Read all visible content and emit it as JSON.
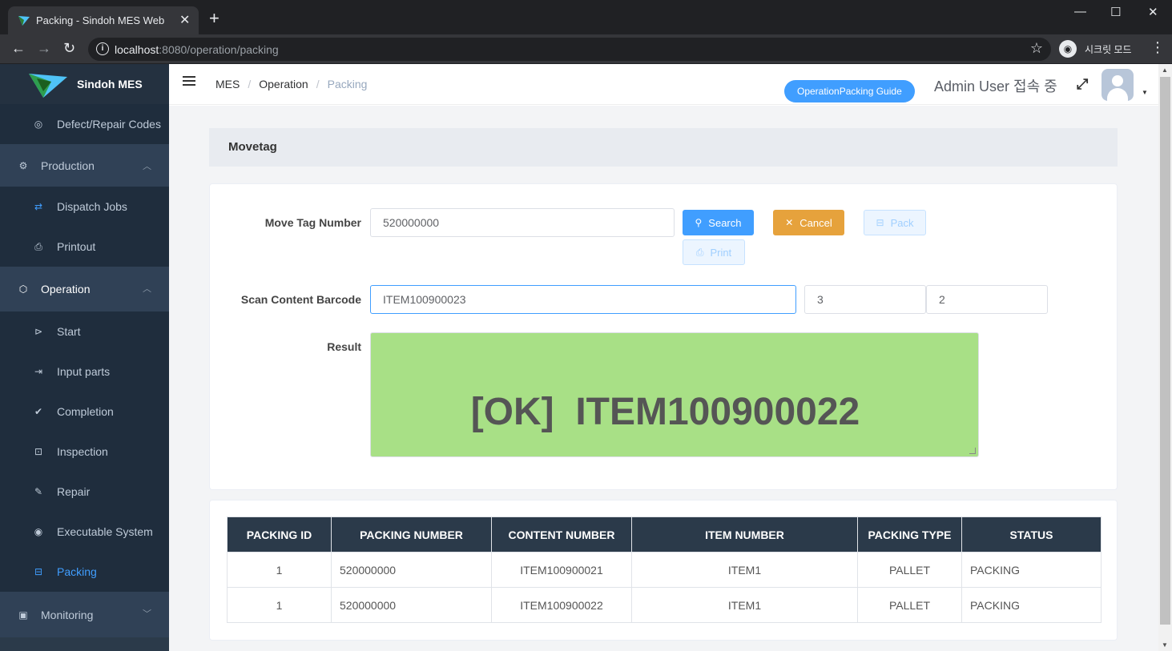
{
  "browser": {
    "tab_title": "Packing - Sindoh MES Web",
    "url_host": "localhost",
    "url_path": ":8080/operation/packing",
    "incognito_label": "시크릿 모드"
  },
  "sidebar": {
    "brand": "Sindoh MES",
    "items": [
      {
        "label": "Defect/Repair Codes",
        "icon": "search-circle-icon",
        "type": "sub"
      },
      {
        "label": "Production",
        "icon": "gear-icon",
        "type": "head",
        "open": true
      },
      {
        "label": "Dispatch Jobs",
        "icon": "sync-icon",
        "type": "sub"
      },
      {
        "label": "Printout",
        "icon": "printer-icon",
        "type": "sub"
      },
      {
        "label": "Operation",
        "icon": "box-icon",
        "type": "head",
        "open": true
      },
      {
        "label": "Start",
        "icon": "play-circle-icon",
        "type": "sub"
      },
      {
        "label": "Input parts",
        "icon": "login-icon",
        "type": "sub"
      },
      {
        "label": "Completion",
        "icon": "check-circle-icon",
        "type": "sub"
      },
      {
        "label": "Inspection",
        "icon": "scan-icon",
        "type": "sub"
      },
      {
        "label": "Repair",
        "icon": "wrench-icon",
        "type": "sub"
      },
      {
        "label": "Executable System",
        "icon": "system-icon",
        "type": "sub"
      },
      {
        "label": "Packing",
        "icon": "packing-icon",
        "type": "sub",
        "active": true
      },
      {
        "label": "Monitoring",
        "icon": "monitor-icon",
        "type": "head",
        "open": false
      }
    ]
  },
  "navbar": {
    "breadcrumbs": [
      "MES",
      "Operation",
      "Packing"
    ],
    "guide_button": "OperationPacking Guide",
    "user_label": "Admin User 접속 중"
  },
  "section": {
    "title": "Movetag"
  },
  "form": {
    "move_tag_label": "Move Tag Number",
    "move_tag_value": "520000000",
    "search_label": "Search",
    "cancel_label": "Cancel",
    "pack_label": "Pack",
    "print_label": "Print",
    "scan_label": "Scan Content Barcode",
    "scan_value": "ITEM100900023",
    "count_a": "3",
    "count_b": "2",
    "result_label": "Result",
    "result_value": "[OK]  ITEM100900022"
  },
  "table": {
    "headers": [
      "PACKING ID",
      "PACKING NUMBER",
      "CONTENT NUMBER",
      "ITEM NUMBER",
      "PACKING TYPE",
      "STATUS"
    ],
    "rows": [
      [
        "1",
        "520000000",
        "ITEM100900021",
        "ITEM1",
        "PALLET",
        "PACKING"
      ],
      [
        "1",
        "520000000",
        "ITEM100900022",
        "ITEM1",
        "PALLET",
        "PACKING"
      ]
    ]
  },
  "colors": {
    "primary": "#409eff",
    "warning": "#e6a23c",
    "result_ok": "#a8e086",
    "sidebar": "#2b3a4a"
  }
}
